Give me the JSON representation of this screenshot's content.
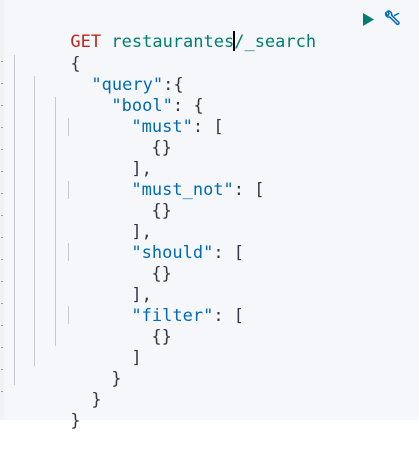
{
  "request": {
    "method": "GET",
    "path_before_cursor": "restaurantes",
    "path_after_cursor": "/_search"
  },
  "actions": {
    "run_icon": "play-icon",
    "settings_icon": "wrench-icon",
    "run_color": "#017d73",
    "settings_color": "#006bb4"
  },
  "body": {
    "open_brace": "{",
    "query_key": "\"query\"",
    "query_suffix": ":{",
    "bool_key": "\"bool\"",
    "bool_suffix": ": {",
    "must_key": "\"must\"",
    "must_suffix": ": [",
    "must_item": "{}",
    "must_close": "],",
    "must_not_key": "\"must_not\"",
    "must_not_suffix": ": [",
    "must_not_item": "{}",
    "must_not_close": "],",
    "should_key": "\"should\"",
    "should_suffix": ": [",
    "should_item": "{}",
    "should_close": "],",
    "filter_key": "\"filter\"",
    "filter_suffix": ": [",
    "filter_item": "{}",
    "filter_close": "]",
    "bool_close": "}",
    "query_close": "}",
    "close_brace": "}"
  }
}
